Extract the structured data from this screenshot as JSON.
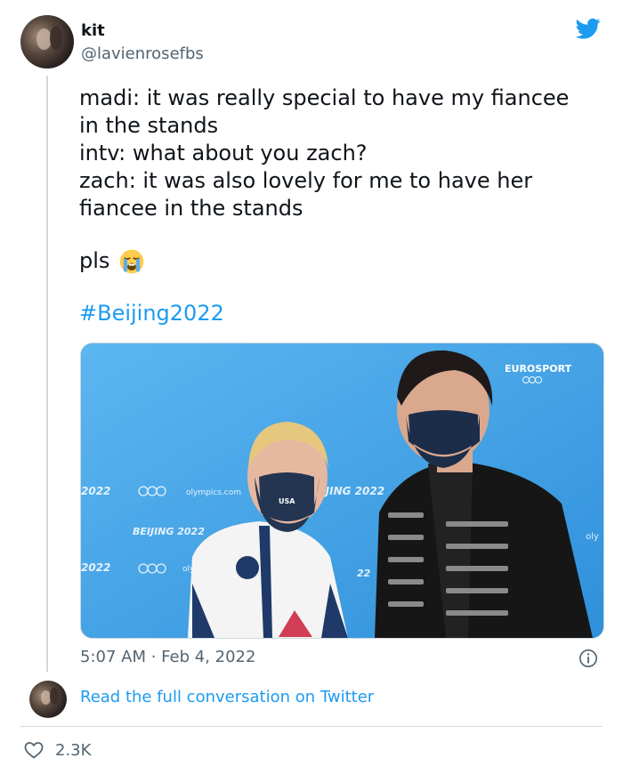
{
  "author": {
    "name": "kit",
    "handle": "@lavienrosefbs"
  },
  "tweet": {
    "text": "madi: it was really special to have my fiancee\nin the stands\nintv: what about you zach?\nzach: it was also lovely for me to have her\nfiancee in the stands",
    "closing": "pls",
    "closing_emoji": "loudly-crying-face-emoji",
    "hashtag": "#Beijing2022"
  },
  "media": {
    "description_icon": "photo",
    "overlay_logo": "EUROSPORT",
    "backdrop_texts": [
      "2022",
      "olympics.com",
      "BEIJING 2022",
      "EIJING 2022",
      "2022",
      "oly",
      "22",
      "oly"
    ],
    "mask_text": "USA"
  },
  "meta": {
    "timestamp": "5:07 AM · Feb 4, 2022"
  },
  "footer": {
    "read_link": "Read the full conversation on Twitter",
    "likes": "2.3K"
  },
  "colors": {
    "accent": "#1d9bf0",
    "muted": "#536471",
    "border": "#cfd9de",
    "media_bg": "#49a7e8"
  }
}
